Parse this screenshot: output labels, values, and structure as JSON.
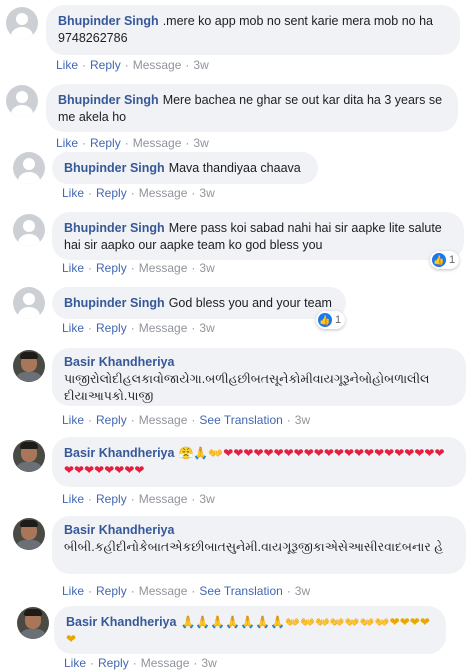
{
  "comments": [
    {
      "name": "Bhupinder Singh",
      "text": ".mere ko app mob no sent karie mera mob no ha 9748262786",
      "actions": {
        "like": "Like",
        "reply": "Reply",
        "message": "Message",
        "time": "3w"
      }
    },
    {
      "name": "Bhupinder Singh",
      "text": "Mere bachea ne ghar se out kar dita ha 3 years se me akela ho",
      "actions": {
        "like": "Like",
        "reply": "Reply",
        "message": "Message",
        "time": "3w"
      }
    },
    {
      "name": "Bhupinder Singh",
      "text": "Mava thandiyaa chaava",
      "actions": {
        "like": "Like",
        "reply": "Reply",
        "message": "Message",
        "time": "3w"
      }
    },
    {
      "name": "Bhupinder Singh",
      "text": "Mere pass koi sabad nahi hai sir aapke lite salute hai sir aapko our aapke team ko god bless you",
      "actions": {
        "like": "Like",
        "reply": "Reply",
        "message": "Message",
        "time": "3w"
      },
      "reactions": {
        "count": "1",
        "icon": "like-icon"
      }
    },
    {
      "name": "Bhupinder Singh",
      "text": "God bless you and your team",
      "actions": {
        "like": "Like",
        "reply": "Reply",
        "message": "Message",
        "time": "3w"
      },
      "reactions": {
        "count": "1",
        "icon": "like-icon"
      }
    },
    {
      "name": "Basir Khandheriya",
      "text": "પાજીરોલોદીહલકાવોજાયેગા.બળીહછીબતસૂનેકોમીવાયગૂરૂનેબોહોબળાલીલ દીયાઆપકો.પાજી",
      "actions": {
        "like": "Like",
        "reply": "Reply",
        "message": "Message",
        "translation": "See Translation",
        "time": "3w"
      }
    },
    {
      "name": "Basir Khandheriya",
      "text": "😤🙏👐❤❤❤❤❤❤❤❤❤❤❤❤❤❤❤❤❤❤❤❤❤❤❤❤❤❤❤❤❤❤",
      "actions": {
        "like": "Like",
        "reply": "Reply",
        "message": "Message",
        "time": "3w"
      }
    },
    {
      "name": "Basir Khandheriya",
      "text": "બીબી.કહીદીનોકેબાતએકછીબાતસુનેમી.વાયગૂરૂજીકાએસેઆસીરવાદબનાર હે",
      "actions": {
        "like": "Like",
        "reply": "Reply",
        "message": "Message",
        "translation": "See Translation",
        "time": "3w"
      }
    },
    {
      "name": "Basir Khandheriya",
      "text": "🙏🙏🙏🙏🙏🙏🙏👐👐👐👐👐👐👐❤❤❤❤❤",
      "actions": {
        "like": "Like",
        "reply": "Reply",
        "message": "Message",
        "time": "3w"
      }
    }
  ]
}
